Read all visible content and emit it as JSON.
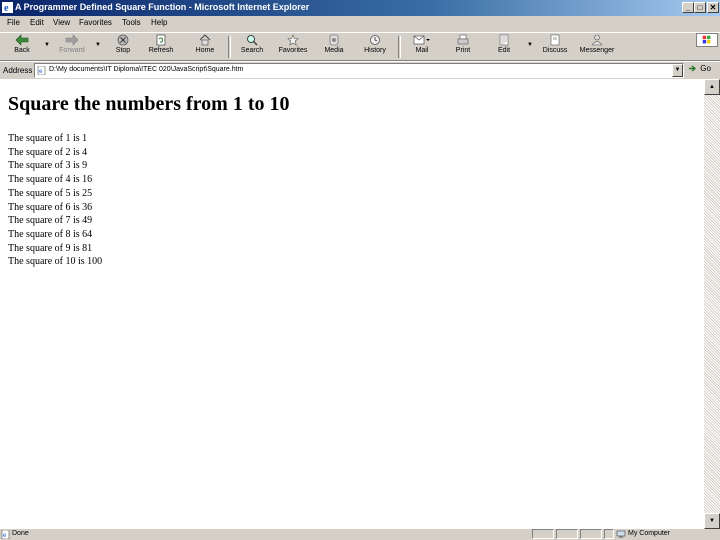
{
  "window": {
    "title": "A Programmer Defined Square Function - Microsoft Internet Explorer",
    "controls": {
      "minimize": "_",
      "maximize": "□",
      "close": "✕"
    }
  },
  "menu": [
    "File",
    "Edit",
    "View",
    "Favorites",
    "Tools",
    "Help"
  ],
  "toolbar": {
    "back": "Back",
    "forward": "Forward",
    "stop": "Stop",
    "refresh": "Refresh",
    "home": "Home",
    "search": "Search",
    "favorites": "Favorites",
    "media": "Media",
    "history": "History",
    "mail": "Mail",
    "print": "Print",
    "edit": "Edit",
    "discuss": "Discuss",
    "messenger": "Messenger"
  },
  "address": {
    "label": "Address",
    "url": "D:\\My documents\\IT Diploma\\ITEC 020\\JavaScript\\Square.htm",
    "go": "Go"
  },
  "page": {
    "heading": "Square the numbers from 1 to 10",
    "lines": [
      "The square of 1 is 1",
      "The square of 2 is 4",
      "The square of 3 is 9",
      "The square of 4 is 16",
      "The square of 5 is 25",
      "The square of 6 is 36",
      "The square of 7 is 49",
      "The square of 8 is 64",
      "The square of 9 is 81",
      "The square of 10 is 100"
    ]
  },
  "status": {
    "text": "Done",
    "zone": "My Computer"
  },
  "colors": {
    "titlebar_start": "#0a246a",
    "titlebar_end": "#a6caf0",
    "chrome": "#d4d0c8"
  }
}
